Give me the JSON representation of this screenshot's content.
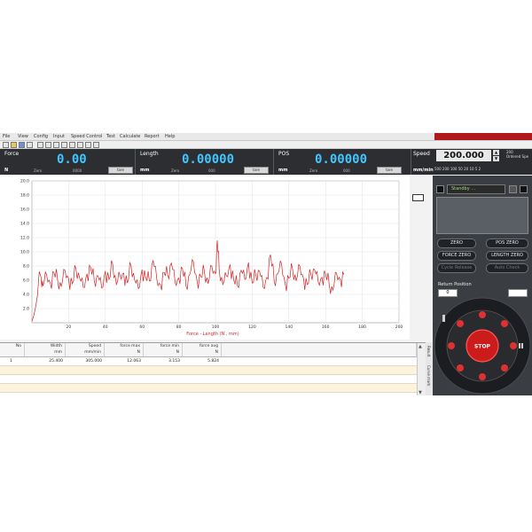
{
  "menu": [
    "File",
    "View",
    "Config",
    "Input",
    "Speed Control",
    "Test",
    "Calculate",
    "Report",
    "Help"
  ],
  "readouts": [
    {
      "title": "Force",
      "value": "0.00",
      "unit": "N",
      "zero_label": "Zero",
      "zero_value": "0000",
      "button": "tare"
    },
    {
      "title": "Length",
      "value": "0.00000",
      "unit": "mm",
      "zero_label": "Zero",
      "zero_value": "000",
      "button": "tare"
    },
    {
      "title": "POS",
      "value": "0.00000",
      "unit": "mm",
      "zero_label": "Zero",
      "zero_value": "000",
      "button": "tare"
    }
  ],
  "speed": {
    "title": "Speed",
    "value": "200.000",
    "unit": "mm/min",
    "max": "200",
    "max_label": "Ordered Spe",
    "steps": "500  200  100  50  20  10  5  2"
  },
  "chart_data": {
    "type": "line",
    "xlabel": "Force - Length   (N , mm)",
    "ylabel": "",
    "xlim": [
      0,
      200
    ],
    "ylim": [
      0,
      20
    ],
    "x_ticks": [
      "20",
      "40",
      "60",
      "80",
      "100",
      "120",
      "140",
      "160",
      "180",
      "200"
    ],
    "y_ticks": [
      "2.0",
      "4.0",
      "6.0",
      "8.0",
      "10.0",
      "12.0",
      "14.0",
      "16.0",
      "18.0",
      "20.0"
    ],
    "grid": true,
    "series": [
      {
        "color": "#d42020",
        "x": [
          0,
          1,
          2,
          3,
          4,
          5,
          6,
          8,
          10,
          12,
          14,
          16,
          18,
          20,
          22,
          24,
          26,
          28,
          30,
          32,
          34,
          36,
          38,
          40,
          42,
          44,
          46,
          48,
          50,
          52,
          54,
          56,
          58,
          60,
          62,
          64,
          66,
          68,
          70,
          72,
          74,
          76,
          78,
          80,
          82,
          84,
          86,
          88,
          90,
          92,
          94,
          96,
          98,
          100,
          101,
          102,
          104,
          106,
          108,
          110,
          112,
          114,
          116,
          118,
          120,
          122,
          124,
          126,
          128,
          130,
          132,
          134,
          136,
          138,
          140,
          142,
          144,
          146,
          148,
          150,
          152,
          154,
          156,
          158,
          160,
          162,
          164,
          166,
          168,
          170
        ],
        "y": [
          0.2,
          1.0,
          2.2,
          3.8,
          7.2,
          6.4,
          5.2,
          6.8,
          5.6,
          7.1,
          6.0,
          5.1,
          7.4,
          6.2,
          5.5,
          7.6,
          6.3,
          5.0,
          6.9,
          7.8,
          5.8,
          6.6,
          4.9,
          7.3,
          6.1,
          8.3,
          5.4,
          6.7,
          7.0,
          5.6,
          8.1,
          6.0,
          4.8,
          7.5,
          6.4,
          5.9,
          8.8,
          6.2,
          5.3,
          7.1,
          6.6,
          8.4,
          5.7,
          6.3,
          7.7,
          5.1,
          6.8,
          8.6,
          5.9,
          6.5,
          7.2,
          5.5,
          8.0,
          6.9,
          11.6,
          7.6,
          5.4,
          6.6,
          8.2,
          6.0,
          5.2,
          7.4,
          6.1,
          8.5,
          5.6,
          6.7,
          7.3,
          5.0,
          6.4,
          9.6,
          5.8,
          6.9,
          8.3,
          5.5,
          6.3,
          7.6,
          5.9,
          8.0,
          6.2,
          5.4,
          6.8,
          7.5,
          5.7,
          6.4,
          6.9,
          5.3,
          4.6,
          7.0,
          6.1,
          6.8
        ]
      }
    ]
  },
  "table": {
    "headers": [
      {
        "line1": "No",
        "line2": ""
      },
      {
        "line1": "Width",
        "line2": "mm"
      },
      {
        "line1": "Speed",
        "line2": "mm/min"
      },
      {
        "line1": "force max",
        "line2": "N"
      },
      {
        "line1": "force min",
        "line2": "N"
      },
      {
        "line1": "force avg",
        "line2": "N"
      }
    ],
    "rows": [
      [
        "1",
        "25.400",
        "305.000",
        "12.063",
        "3.153",
        "5.824"
      ]
    ]
  },
  "side_tabs": [
    "Result",
    "Curve mark"
  ],
  "control": {
    "status": "Standby ...",
    "buttons": [
      "ZERO",
      "POS ZERO",
      "FORCE ZERO",
      "LENGTH ZERO",
      "Cycle Release",
      "Auto Check"
    ],
    "return_label": "Return Position",
    "return_value": "0",
    "stop_label": "STOP"
  },
  "colors": {
    "accent": "#41c6ff",
    "panel": "#303236",
    "stop": "#cc1b1b",
    "curve": "#d42020"
  }
}
